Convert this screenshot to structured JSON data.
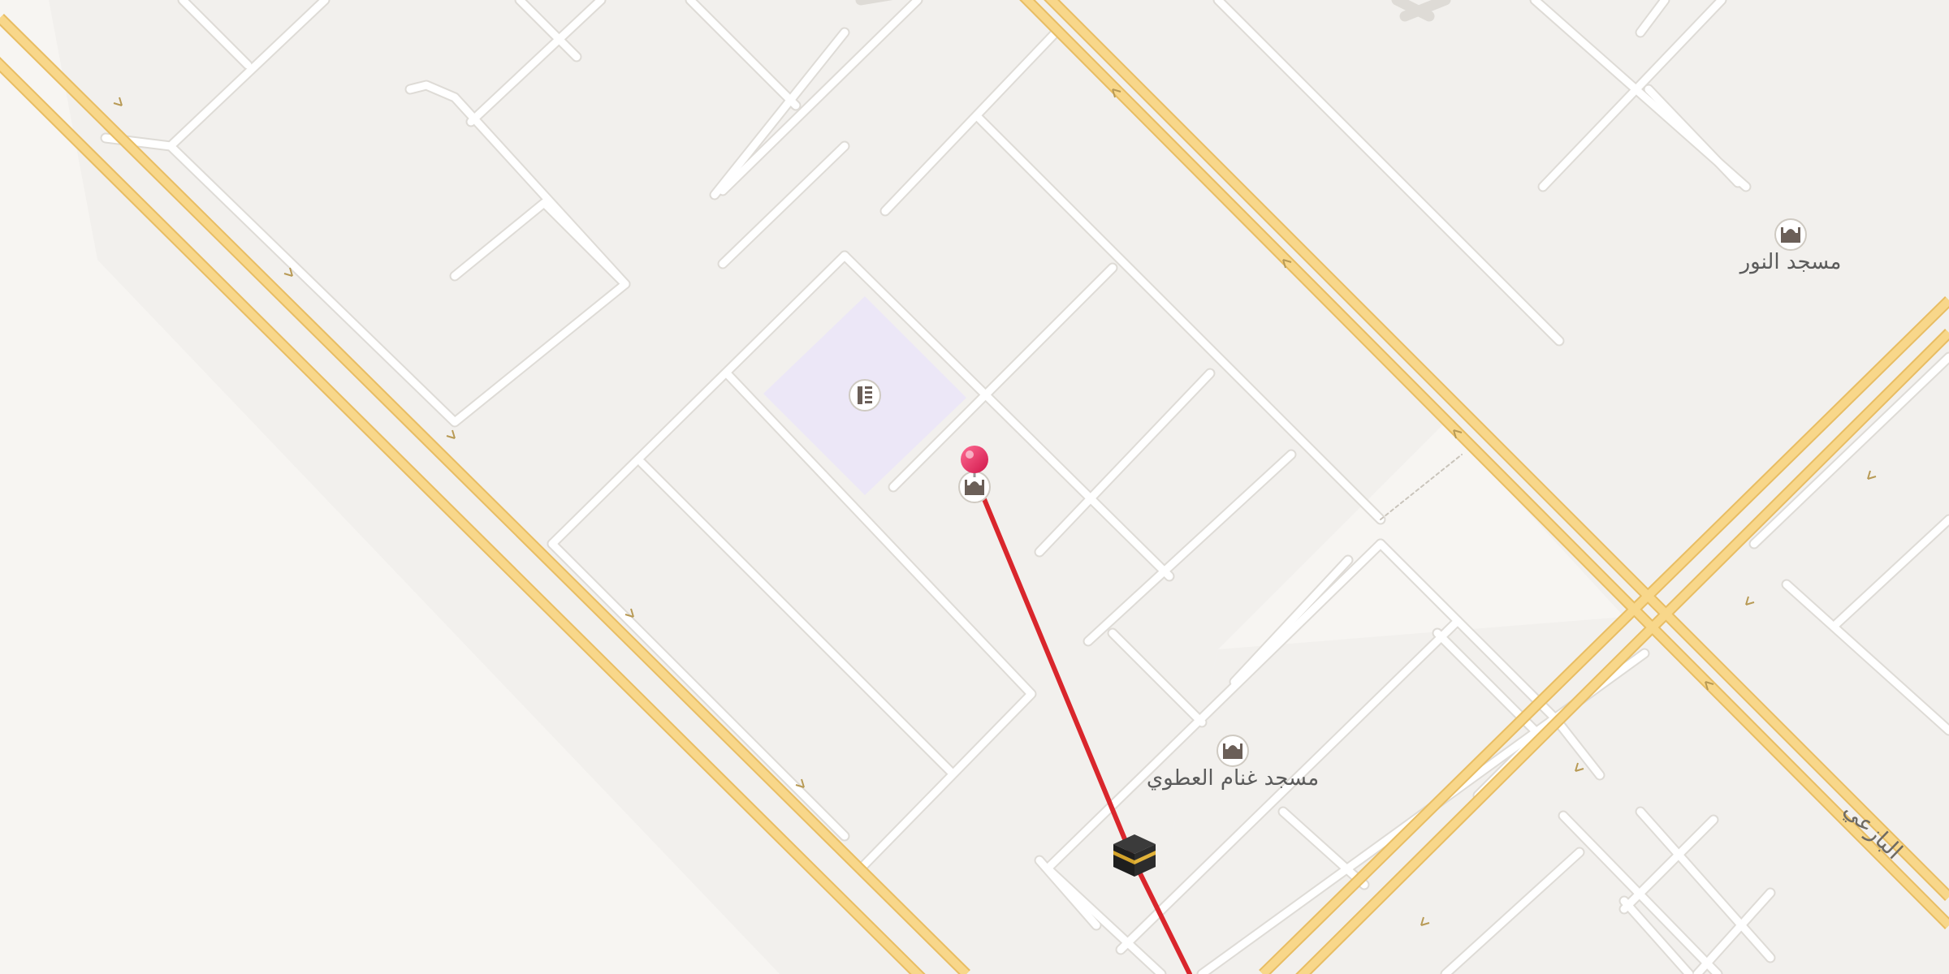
{
  "map": {
    "background_color": "#f7f5f2",
    "block_color": "#f2f0ed",
    "street_color": "#ffffff",
    "highway_color": "#f8d78a",
    "highway_edge_color": "#e8bd63",
    "route_color": "#d9262c",
    "pin_color": "#e8255d",
    "highlight_area_color": "#ece7f7"
  },
  "places": [
    {
      "name": "مسجد النور",
      "icon": "mosque-icon"
    },
    {
      "name": "مسجد غنام العطوي",
      "icon": "mosque-icon"
    }
  ],
  "road_labels": [
    {
      "name": "البازعي"
    }
  ],
  "markers": {
    "pin": {
      "icon": "location-pin-icon"
    },
    "origin_poi": {
      "icon": "mosque-icon"
    },
    "area_poi": {
      "icon": "school-icon"
    },
    "qibla": {
      "icon": "kaaba-icon"
    }
  }
}
